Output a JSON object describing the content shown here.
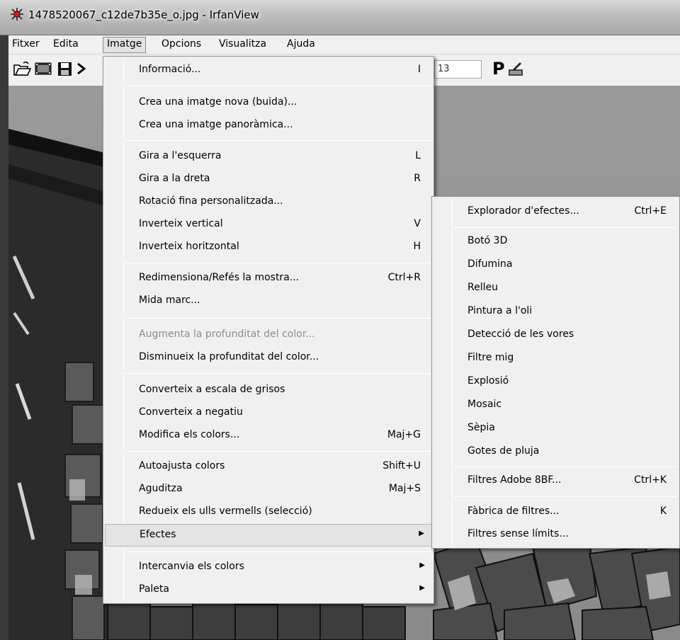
{
  "window": {
    "title": "1478520067_c12de7b35e_o.jpg - IrfanView"
  },
  "menubar": {
    "items": [
      {
        "label": "Fitxer"
      },
      {
        "label": "Edita"
      },
      {
        "label": "Imatge"
      },
      {
        "label": "Opcions"
      },
      {
        "label": "Visualitza"
      },
      {
        "label": "Ajuda"
      }
    ]
  },
  "toolbar": {
    "field_value": "13",
    "p_label": "P",
    "icons": [
      "open-folder-icon",
      "slideshow-icon",
      "save-icon",
      "close-icon",
      "paint-icon"
    ]
  },
  "image_menu": {
    "items": [
      {
        "label": "Informació...",
        "shortcut": "I"
      },
      {
        "label": "Crea una imatge nova (buida)...",
        "shortcut": ""
      },
      {
        "label": "Crea una imatge panoràmica...",
        "shortcut": ""
      },
      {
        "label": "Gira a l'esquerra",
        "shortcut": "L"
      },
      {
        "label": "Gira a la dreta",
        "shortcut": "R"
      },
      {
        "label": "Rotació fina personalitzada...",
        "shortcut": ""
      },
      {
        "label": "Inverteix vertical",
        "shortcut": "V"
      },
      {
        "label": "Inverteix horitzontal",
        "shortcut": "H"
      },
      {
        "label": "Redimensiona/Refés la mostra...",
        "shortcut": "Ctrl+R"
      },
      {
        "label": "Mida marc...",
        "shortcut": ""
      },
      {
        "label": "Augmenta la profunditat del color...",
        "shortcut": "",
        "disabled": true
      },
      {
        "label": "Disminueix la profunditat del color...",
        "shortcut": ""
      },
      {
        "label": "Converteix a escala de grisos",
        "shortcut": ""
      },
      {
        "label": "Converteix a negatiu",
        "shortcut": ""
      },
      {
        "label": "Modifica els colors...",
        "shortcut": "Maj+G"
      },
      {
        "label": "Autoajusta colors",
        "shortcut": "Shift+U"
      },
      {
        "label": "Aguditza",
        "shortcut": "Maj+S"
      },
      {
        "label": "Redueix els ulls vermells (selecció)",
        "shortcut": ""
      },
      {
        "label": "Efectes",
        "shortcut": "",
        "submenu": true,
        "highlighted": true
      },
      {
        "label": "Intercanvia els colors",
        "shortcut": "",
        "submenu": true
      },
      {
        "label": "Paleta",
        "shortcut": "",
        "submenu": true
      }
    ]
  },
  "effects_menu": {
    "items": [
      {
        "label": "Explorador d'efectes...",
        "shortcut": "Ctrl+E"
      },
      {
        "label": "Botó 3D",
        "shortcut": ""
      },
      {
        "label": "Difumina",
        "shortcut": ""
      },
      {
        "label": "Relleu",
        "shortcut": ""
      },
      {
        "label": "Pintura a l'oli",
        "shortcut": ""
      },
      {
        "label": "Detecció de les vores",
        "shortcut": ""
      },
      {
        "label": "Filtre mig",
        "shortcut": ""
      },
      {
        "label": "Explosió",
        "shortcut": ""
      },
      {
        "label": "Mosaic",
        "shortcut": ""
      },
      {
        "label": "Sèpia",
        "shortcut": ""
      },
      {
        "label": "Gotes de pluja",
        "shortcut": ""
      },
      {
        "label": "Filtres Adobe 8BF...",
        "shortcut": "Ctrl+K"
      },
      {
        "label": "Fàbrica de filtres...",
        "shortcut": "K"
      },
      {
        "label": "Filtres sense límits...",
        "shortcut": ""
      }
    ]
  }
}
